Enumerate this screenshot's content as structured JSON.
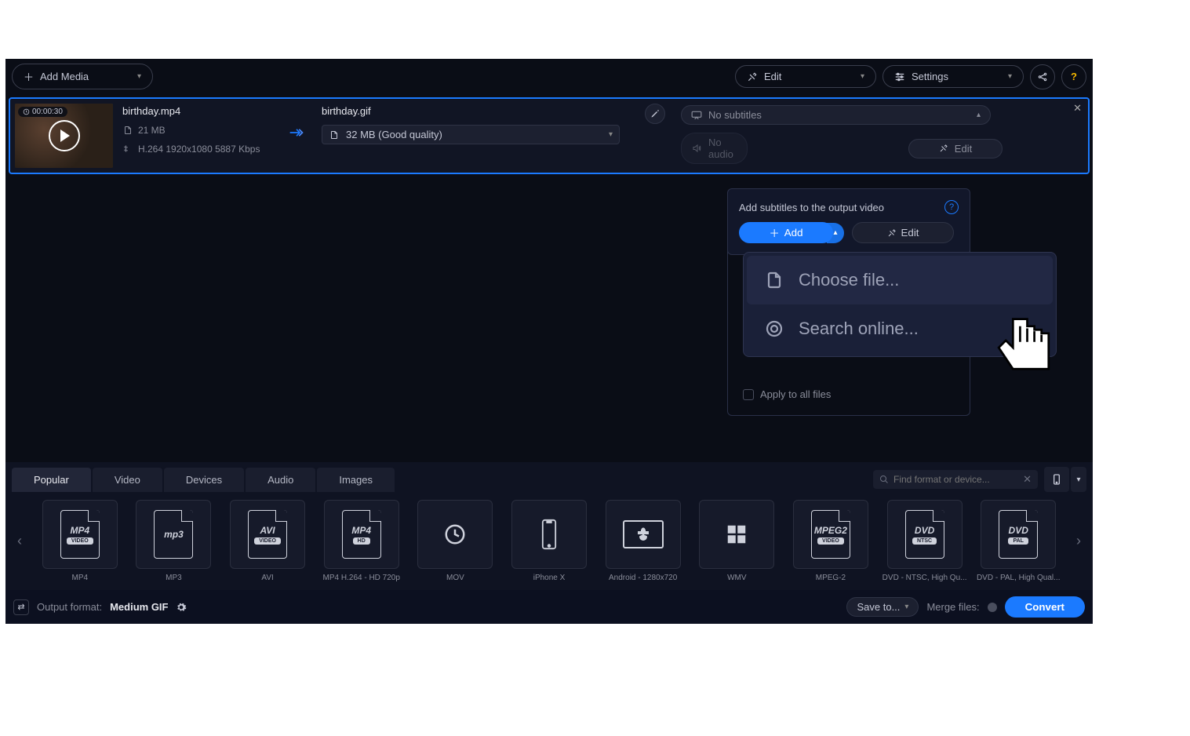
{
  "toolbar": {
    "add_media": "Add Media",
    "edit": "Edit",
    "settings": "Settings"
  },
  "file": {
    "duration": "00:00:30",
    "input_name": "birthday.mp4",
    "input_size": "21 MB",
    "input_info": "H.264 1920x1080 5887 Kbps",
    "output_name": "birthday.gif",
    "output_size_quality": "32 MB (Good quality)",
    "subtitles": "No subtitles",
    "audio": "No audio",
    "edit_label": "Edit"
  },
  "panel": {
    "title": "Add subtitles to the output video",
    "add": "Add",
    "edit": "Edit",
    "choose_file": "Choose file...",
    "search_online": "Search online...",
    "apply_all": "Apply to all files"
  },
  "tabs": {
    "popular": "Popular",
    "video": "Video",
    "devices": "Devices",
    "audio": "Audio",
    "images": "Images"
  },
  "search": {
    "placeholder": "Find format or device..."
  },
  "formats": [
    {
      "main": "MP4",
      "sub": "VIDEO",
      "label": "MP4"
    },
    {
      "main": "mp3",
      "sub": "",
      "label": "MP3"
    },
    {
      "main": "AVI",
      "sub": "VIDEO",
      "label": "AVI"
    },
    {
      "main": "MP4",
      "sub": "HD",
      "label": "MP4 H.264 - HD 720p"
    },
    {
      "main": "",
      "sub": "",
      "label": "MOV"
    },
    {
      "main": "",
      "sub": "",
      "label": "iPhone X"
    },
    {
      "main": "",
      "sub": "",
      "label": "Android - 1280x720"
    },
    {
      "main": "",
      "sub": "",
      "label": "WMV"
    },
    {
      "main": "MPEG2",
      "sub": "VIDEO",
      "label": "MPEG-2"
    },
    {
      "main": "DVD",
      "sub": "NTSC",
      "label": "DVD - NTSC, High Qu..."
    },
    {
      "main": "DVD",
      "sub": "PAL",
      "label": "DVD - PAL, High Qual..."
    }
  ],
  "footer": {
    "output_format_label": "Output format:",
    "output_format": "Medium GIF",
    "save_to": "Save to...",
    "merge": "Merge files:",
    "convert": "Convert"
  }
}
